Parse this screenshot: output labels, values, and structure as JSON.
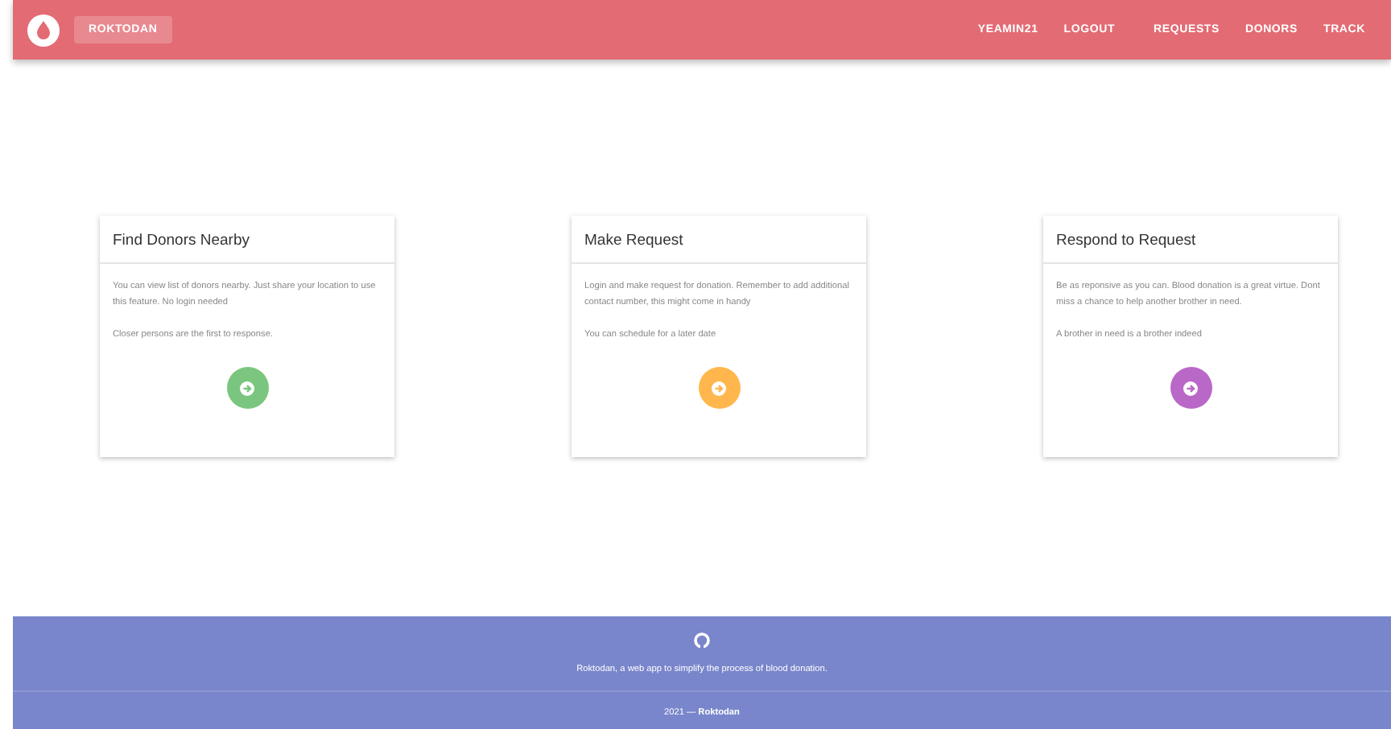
{
  "navbar": {
    "brand": "ROKTODAN",
    "links": [
      {
        "label": "YEAMIN21"
      },
      {
        "label": "LOGOUT"
      },
      {
        "label": "REQUESTS"
      },
      {
        "label": "DONORS"
      },
      {
        "label": "TRACK"
      }
    ]
  },
  "cards": [
    {
      "title": "Find Donors Nearby",
      "paragraphs": [
        "You can view list of donors nearby. Just share your location to use this feature. No login needed",
        "Closer persons are the first to response."
      ],
      "color": "#7bc67e"
    },
    {
      "title": "Make Request",
      "paragraphs": [
        "Login and make request for donation. Remember to add additional contact number, this might come in handy",
        "You can schedule for a later date"
      ],
      "color": "#ffb74d"
    },
    {
      "title": "Respond to Request",
      "paragraphs": [
        "Be as reponsive as you can. Blood donation is a great virtue. Dont miss a chance to help another brother in need.",
        "A brother in need is a brother indeed"
      ],
      "color": "#ba68c8"
    }
  ],
  "footer": {
    "tagline": "Roktodan, a web app to simplify the process of blood donation.",
    "copyright": "2021 — **Roktodan**"
  }
}
